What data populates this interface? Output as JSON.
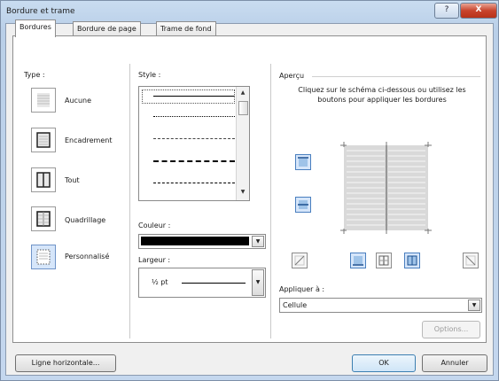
{
  "window": {
    "title": "Bordure et trame",
    "help_label": "?",
    "close_label": "X"
  },
  "tabs": [
    {
      "label": "Bordures",
      "active": true
    },
    {
      "label": "Bordure de page",
      "active": false
    },
    {
      "label": "Trame de fond",
      "active": false
    }
  ],
  "type_section": {
    "label": "Type :",
    "items": [
      {
        "label": "Aucune",
        "selected": false
      },
      {
        "label": "Encadrement",
        "selected": false
      },
      {
        "label": "Tout",
        "selected": false
      },
      {
        "label": "Quadrillage",
        "selected": false
      },
      {
        "label": "Personnalisé",
        "selected": true
      }
    ]
  },
  "style_section": {
    "label": "Style :",
    "line_styles": [
      "solid",
      "dotted",
      "dash-small",
      "dashed",
      "dash-dot"
    ]
  },
  "color": {
    "label": "Couleur :",
    "value": "#000000"
  },
  "width": {
    "label": "Largeur :",
    "value": "½ pt"
  },
  "preview": {
    "label": "Aperçu",
    "instructions": "Cliquez sur le schéma ci-dessous ou utilisez les boutons pour appliquer les bordures"
  },
  "apply": {
    "label": "Appliquer à :",
    "value": "Cellule"
  },
  "buttons": {
    "options": "Options...",
    "horizontal_line": "Ligne horizontale...",
    "ok": "OK",
    "cancel": "Annuler"
  },
  "colors": {
    "accent": "#3c7fb1",
    "selected_fill": "#d6e6fa",
    "title_gradient": "#c4d7ee"
  }
}
